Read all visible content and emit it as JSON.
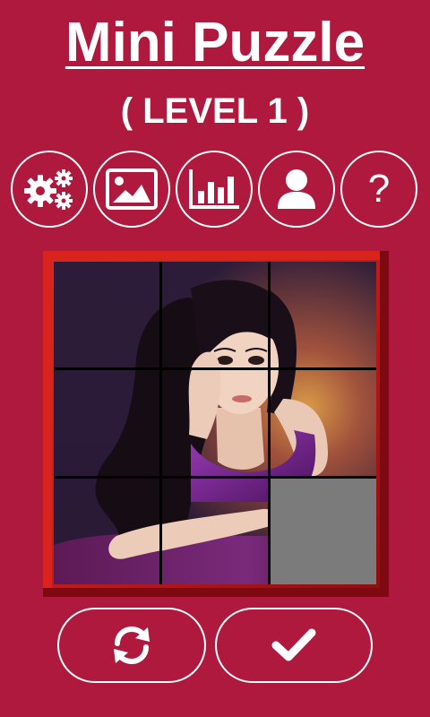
{
  "header": {
    "title": "Mini Puzzle",
    "level": "( LEVEL 1 )"
  },
  "toolbar": {
    "buttons": [
      {
        "icon": "gears-icon"
      },
      {
        "icon": "image-icon"
      },
      {
        "icon": "bar-chart-icon"
      },
      {
        "icon": "user-icon"
      },
      {
        "icon": "help-icon",
        "glyph": "?"
      }
    ]
  },
  "puzzle": {
    "grid": "3x3",
    "empty_tile": 9,
    "image": "woman-portrait"
  },
  "actions": {
    "shuffle_icon": "refresh-icon",
    "confirm_icon": "check-icon"
  },
  "colors": {
    "background": "#b0193e",
    "frame": "#c41b18",
    "empty_tile": "#7b7b7b",
    "foreground": "#ffffff"
  }
}
